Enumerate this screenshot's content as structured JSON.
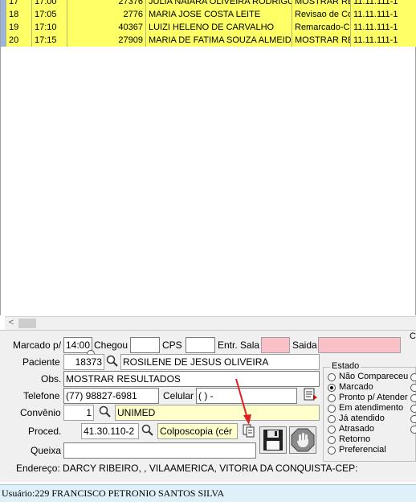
{
  "grid": {
    "rows": [
      {
        "num": "17",
        "time": "17:00",
        "code": "27376",
        "name": "JULIA NAIARA OLIVEIRA RODRIGUE",
        "obs": "MOSTRAR RE",
        "plan": "11.11.111-1"
      },
      {
        "num": "18",
        "time": "17:05",
        "code": "2776",
        "name": "MARIA JOSE COSTA LEITE",
        "obs": "Revisao de Co",
        "plan": "11.11.111-1"
      },
      {
        "num": "19",
        "time": "17:10",
        "code": "40367",
        "name": "LUIZI HELENO DE CARVALHO",
        "obs": "Remarcado-C(",
        "plan": "11.11.111-1"
      },
      {
        "num": "20",
        "time": "17:15",
        "code": "27909",
        "name": "MARIA DE FATIMA SOUZA ALMEIDA",
        "obs": "MOSTRAR RE",
        "plan": "11.11.111-1"
      }
    ]
  },
  "scroll": {
    "left_arrow": "<"
  },
  "form": {
    "marcado_label": "Marcado p/",
    "marcado_value": "14:00",
    "chegou_label": "Chegou",
    "chegou_value": "",
    "cps_label": "CPS",
    "cps_value": "",
    "entr_sala_label": "Entr. Sala",
    "entr_sala_value": "",
    "saida_label": "Saida",
    "saida_value": "",
    "paciente_label": "Paciente",
    "paciente_code": "18373",
    "paciente_name": "ROSILENE DE JESUS OLIVEIRA",
    "obs_label": "Obs.",
    "obs_value": "MOSTRAR RESULTADOS",
    "telefone_label": "Telefone",
    "telefone_value": "(77) 98827-6981",
    "celular_label": "Celular",
    "celular_value": "( )    -",
    "convenio_label": "Convênio",
    "convenio_code": "1",
    "convenio_name": "UNIMED",
    "proced_label": "Proced.",
    "proced_code": "41.30.110-2",
    "proced_name": "Colposcopia (cér",
    "queixa_label": "Queixa",
    "queixa_value": "",
    "endereco": "Endereço: DARCY RIBEIRO, , VILAAMERICA, VITORIA DA CONQUISTA-CEP:",
    "corner_label": "C"
  },
  "estado": {
    "title": "Estado",
    "options": [
      {
        "label": "Não Compareceu",
        "checked": false
      },
      {
        "label": "Marcado",
        "checked": true
      },
      {
        "label": "Pronto p/ Atender",
        "checked": false
      },
      {
        "label": "Em atendimento",
        "checked": false
      },
      {
        "label": "Já atendido",
        "checked": false
      },
      {
        "label": "Atrasado",
        "checked": false
      },
      {
        "label": "Retorno",
        "checked": false
      },
      {
        "label": "Preferencial",
        "checked": false
      }
    ]
  },
  "status": {
    "user": "Usuário:229 FRANCISCO PETRONIO SANTOS SILVA"
  },
  "colors": {
    "row_highlight": "#ffff66",
    "pink_field": "#f9c0c8",
    "status_bg": "#dff0f8",
    "arrow": "#e02020"
  }
}
